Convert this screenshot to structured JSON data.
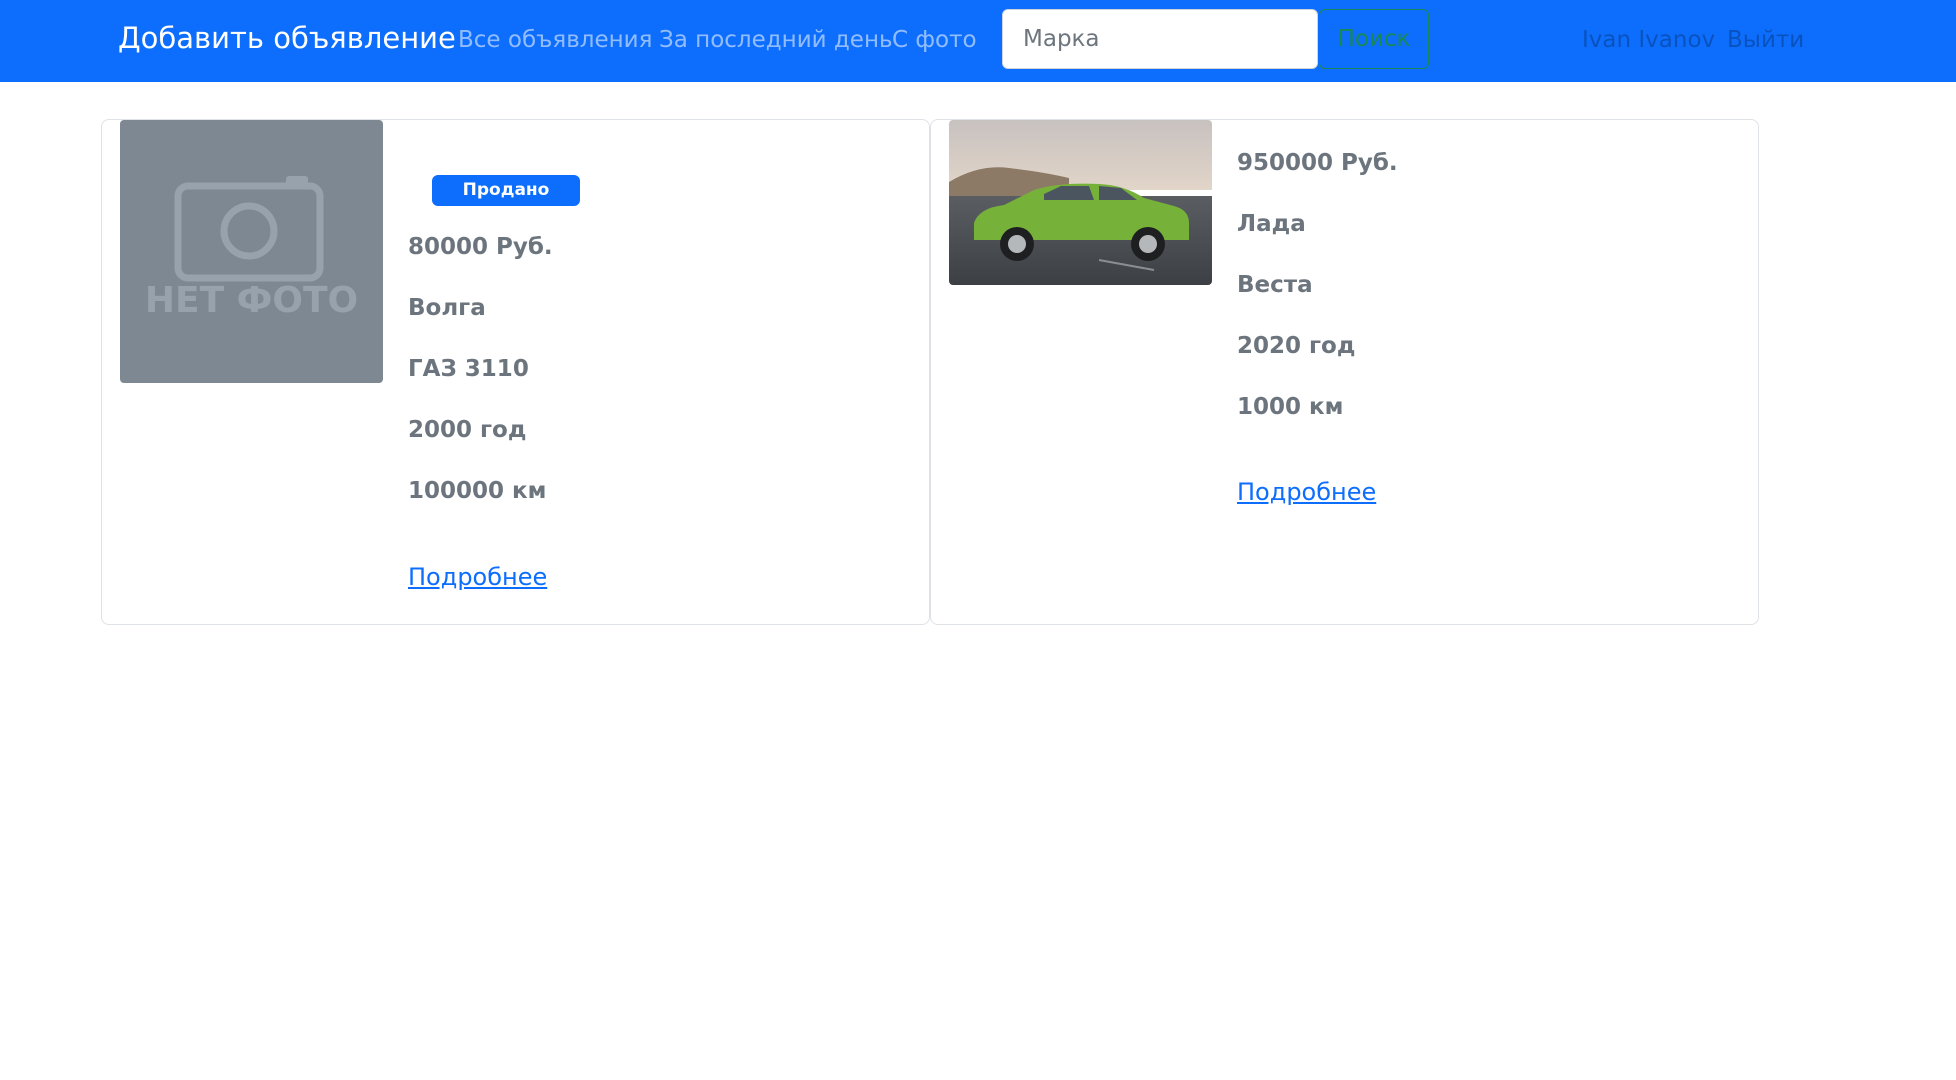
{
  "navbar": {
    "brand": "Добавить объявление",
    "links": [
      "Все объявления",
      "За последний день",
      "С фото"
    ],
    "search": {
      "value": "",
      "placeholder": "Марка",
      "button_label": "Поиск"
    },
    "user_name": "Ivan Ivanov",
    "logout_label": "Выйти",
    "background": "#0d6efd"
  },
  "listings": [
    {
      "image": {
        "kind": "placeholder",
        "label": "НЕТ ФОТО"
      },
      "status_badge": "Продано",
      "price": "80000 Руб.",
      "brand": "Волга",
      "model": "ГАЗ 3110",
      "year": "2000 год",
      "mileage": "100000 км",
      "details_label": "Подробнее"
    },
    {
      "image": {
        "kind": "photo",
        "car_color": "#76b23a"
      },
      "status_badge": "",
      "price": "950000 Руб.",
      "brand": "Лада",
      "model": "Веста",
      "year": "2020 год",
      "mileage": "1000 км",
      "details_label": "Подробнее"
    }
  ]
}
